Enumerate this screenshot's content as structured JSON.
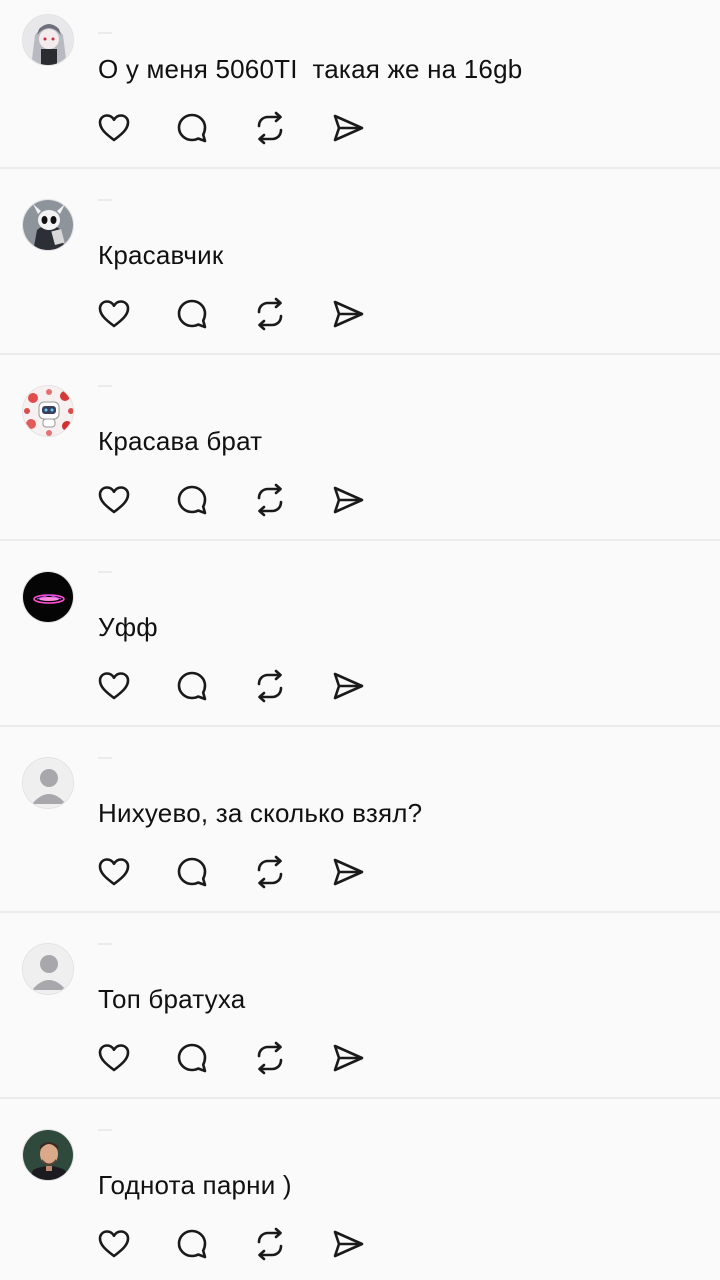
{
  "posts": [
    {
      "avatar": "anime-girl-avatar",
      "text": "О у меня 5060TI  такая же на 16gb"
    },
    {
      "avatar": "skull-mask-avatar",
      "text": "Красавчик"
    },
    {
      "avatar": "robot-collage-avatar",
      "text": "Красава брат"
    },
    {
      "avatar": "neon-logo-avatar",
      "text": "Уфф"
    },
    {
      "avatar": "default-user-avatar",
      "text": "Нихуево, за сколько взял?"
    },
    {
      "avatar": "default-user-avatar",
      "text": "Топ братуха"
    },
    {
      "avatar": "man-photo-avatar",
      "text": "Годнота парни )"
    }
  ],
  "actions": [
    "heart-icon",
    "comment-icon",
    "repost-icon",
    "send-icon"
  ],
  "colors": {
    "background": "#fafafa",
    "divider": "#ececec",
    "text": "#111111",
    "icon": "#1a1a1a"
  }
}
